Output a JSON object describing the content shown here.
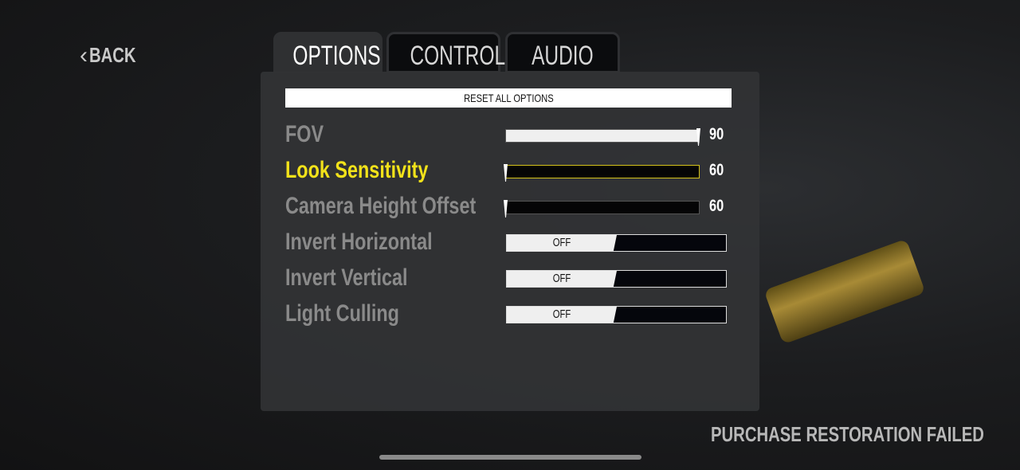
{
  "nav": {
    "back_label": "BACK"
  },
  "tabs": [
    {
      "label": "OPTIONS",
      "active": true
    },
    {
      "label": "CONTROLS",
      "active": false
    },
    {
      "label": "AUDIO",
      "active": false
    }
  ],
  "options": {
    "reset_label": "RESET ALL OPTIONS",
    "sliders": [
      {
        "label": "FOV",
        "value": "90",
        "fill": 1.0,
        "selected": false
      },
      {
        "label": "Look Sensitivity",
        "value": "60",
        "fill": 0.0,
        "selected": true
      },
      {
        "label": "Camera Height Offset",
        "value": "60",
        "fill": 0.0,
        "selected": false
      }
    ],
    "toggles": [
      {
        "label": "Invert Horizontal",
        "value": "OFF"
      },
      {
        "label": "Invert Vertical",
        "value": "OFF"
      },
      {
        "label": "Light Culling",
        "value": "OFF"
      }
    ]
  },
  "status_message": "PURCHASE RESTORATION FAILED",
  "colors": {
    "selected": "#f2e21a",
    "label": "#8a8a8a"
  }
}
